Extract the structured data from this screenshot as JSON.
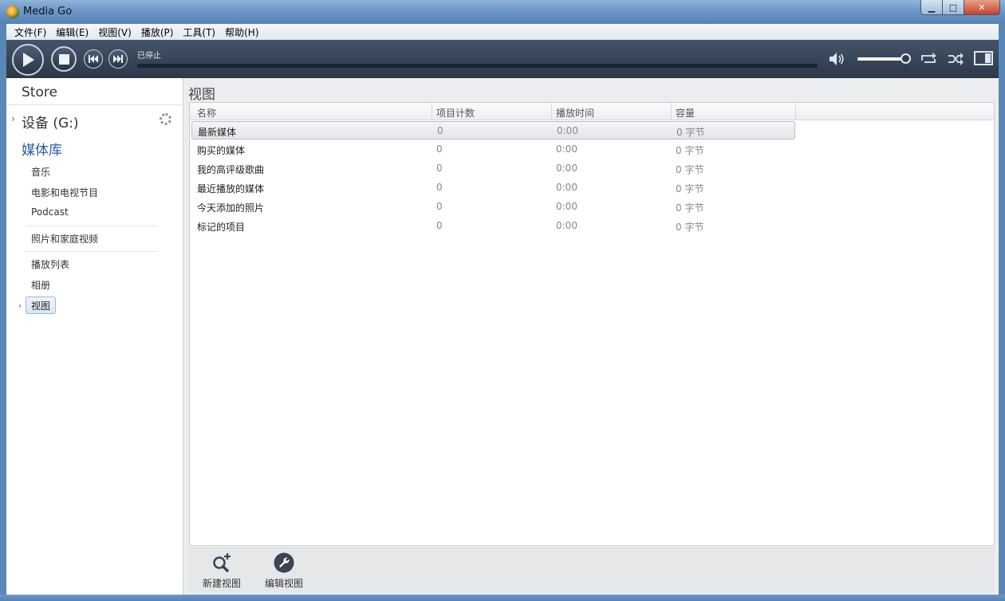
{
  "window": {
    "title": "Media Go",
    "min_symbol": "▁",
    "max_symbol": "□",
    "close_symbol": "✕"
  },
  "menu": [
    "文件(F)",
    "编辑(E)",
    "视图(V)",
    "播放(P)",
    "工具(T)",
    "帮助(H)"
  ],
  "player": {
    "status": "已停止",
    "progress": 0,
    "volume": 0.9
  },
  "sidebar": {
    "store": "Store",
    "device": "设备 (G:)",
    "library": "媒体库",
    "items": [
      "音乐",
      "电影和电视节目",
      "Podcast",
      "照片和家庭视频",
      "播放列表",
      "相册",
      "视图"
    ]
  },
  "main": {
    "title": "视图",
    "columns": [
      "名称",
      "项目计数",
      "播放时间",
      "容量"
    ],
    "rows": [
      {
        "name": "最新媒体",
        "count": "0",
        "time": "0:00",
        "size": "0 字节"
      },
      {
        "name": "购买的媒体",
        "count": "0",
        "time": "0:00",
        "size": "0 字节"
      },
      {
        "name": "我的高评级歌曲",
        "count": "0",
        "time": "0:00",
        "size": "0 字节"
      },
      {
        "name": "最近播放的媒体",
        "count": "0",
        "time": "0:00",
        "size": "0 字节"
      },
      {
        "name": "今天添加的照片",
        "count": "0",
        "time": "0:00",
        "size": "0 字节"
      },
      {
        "name": "标记的项目",
        "count": "0",
        "time": "0:00",
        "size": "0 字节"
      }
    ]
  },
  "actions": {
    "new_view": "新建视图",
    "edit_view": "编辑视图"
  },
  "icons": {
    "play": "play-icon",
    "stop": "stop-icon",
    "prev": "previous-icon",
    "next": "next-icon",
    "volume": "volume-icon",
    "repeat": "repeat-icon",
    "shuffle": "shuffle-icon",
    "layout": "layout-icon",
    "new_view": "search-plus-icon",
    "edit_view": "wrench-icon"
  },
  "colors": {
    "accent": "#2a5aa0",
    "toolbar": "#2c3848"
  }
}
